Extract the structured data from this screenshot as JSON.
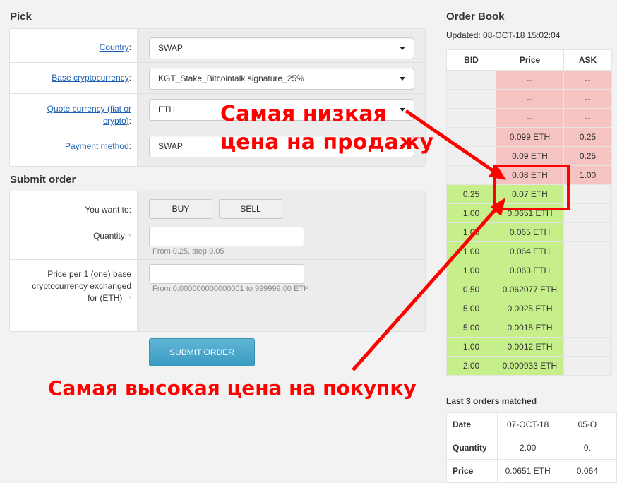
{
  "pick": {
    "title": "Pick",
    "country": {
      "label": "Country",
      "value": "SWAP"
    },
    "base": {
      "label": "Base cryptocurrency",
      "value": "KGT_Stake_Bitcointalk signature_25%"
    },
    "quote": {
      "label_1": "Quote currency (fiat or",
      "label_2": "crypto)",
      "value": "ETH"
    },
    "payment": {
      "label": "Payment method",
      "value": "SWAP"
    }
  },
  "submit": {
    "title": "Submit order",
    "want_label": "You want to:",
    "buy": "BUY",
    "sell": "SELL",
    "quantity_label": "Quantity:",
    "quantity_hint": "From 0.25, step 0.05",
    "price_label_1": "Price per 1 (one) base",
    "price_label_2": "cryptocurrency exchanged",
    "price_label_3": "for (ETH) :",
    "price_hint": "From 0.000000000000001 to 999999.00 ETH",
    "button": "SUBMIT ORDER",
    "required_mark": "*"
  },
  "order_book": {
    "title": "Order Book",
    "updated": "Updated: 08-OCT-18 15:02:04",
    "headers": [
      "BID",
      "Price",
      "ASK"
    ],
    "rows": [
      {
        "bid": "",
        "price": "--",
        "ask": "--",
        "kind": "sell"
      },
      {
        "bid": "",
        "price": "--",
        "ask": "--",
        "kind": "sell"
      },
      {
        "bid": "",
        "price": "--",
        "ask": "--",
        "kind": "sell"
      },
      {
        "bid": "",
        "price": "0.099 ETH",
        "ask": "0.25",
        "kind": "sell"
      },
      {
        "bid": "",
        "price": "0.09 ETH",
        "ask": "0.25",
        "kind": "sell"
      },
      {
        "bid": "",
        "price": "0.08 ETH",
        "ask": "1.00",
        "kind": "sell"
      },
      {
        "bid": "0.25",
        "price": "0.07 ETH",
        "ask": "",
        "kind": "buy"
      },
      {
        "bid": "1.00",
        "price": "0.0651 ETH",
        "ask": "",
        "kind": "buy"
      },
      {
        "bid": "1.00",
        "price": "0.065 ETH",
        "ask": "",
        "kind": "buy"
      },
      {
        "bid": "1.00",
        "price": "0.064 ETH",
        "ask": "",
        "kind": "buy"
      },
      {
        "bid": "1.00",
        "price": "0.063 ETH",
        "ask": "",
        "kind": "buy"
      },
      {
        "bid": "0.50",
        "price": "0.062077 ETH",
        "ask": "",
        "kind": "buy"
      },
      {
        "bid": "5.00",
        "price": "0.0025 ETH",
        "ask": "",
        "kind": "buy"
      },
      {
        "bid": "5.00",
        "price": "0.0015 ETH",
        "ask": "",
        "kind": "buy"
      },
      {
        "bid": "1.00",
        "price": "0.0012 ETH",
        "ask": "",
        "kind": "buy"
      },
      {
        "bid": "2.00",
        "price": "0.000933 ETH",
        "ask": "",
        "kind": "buy"
      }
    ]
  },
  "last_orders": {
    "title": "Last 3 orders matched",
    "rows": [
      {
        "label": "Date",
        "values": [
          "07-OCT-18",
          "05-O"
        ]
      },
      {
        "label": "Quantity",
        "values": [
          "2.00",
          "0."
        ]
      },
      {
        "label": "Price",
        "values": [
          "0.0651 ETH",
          "0.064"
        ]
      }
    ]
  },
  "annotations": {
    "lowest_sell_1": "Самая низкая",
    "lowest_sell_2": "цена на продажу",
    "highest_buy": "Самая высокая цена на покупку"
  },
  "colors": {
    "sell_row": "#f6c3c3",
    "buy_row": "#c6ee8a",
    "annotation": "#ff0000",
    "submit_button": "#4aa8cc"
  }
}
